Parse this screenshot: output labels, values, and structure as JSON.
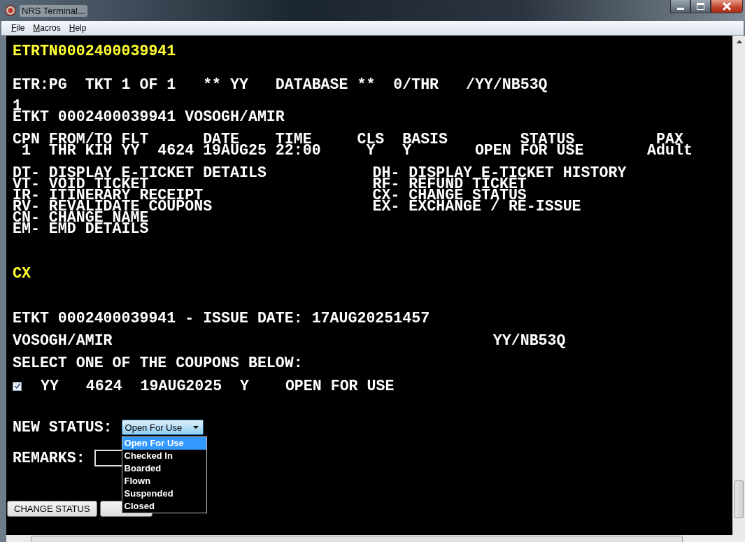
{
  "window": {
    "title": "NRS Terminal..."
  },
  "menu": [
    {
      "label": "File"
    },
    {
      "label": "Macros"
    },
    {
      "label": "Help"
    }
  ],
  "terminal": {
    "command": "ETRTN0002400039941",
    "header": "ETR:PG  TKT 1 OF 1   ** YY   DATABASE **  0/THR   /YY/NB53Q",
    "ticket_lines": [
      "1",
      "ETKT 0002400039941 VOSOGH/AMIR"
    ],
    "coupon_table": {
      "header": "CPN FROM/TO FLT      DATE    TIME     CLS  BASIS        STATUS         PAX",
      "rows": [
        " 1  THR KIH YY  4624 19AUG25 22:00     Y   Y       OPEN FOR USE       Adult"
      ]
    },
    "options": {
      "left": [
        "DT- DISPLAY E-TICKET DETAILS",
        "VT- VOID TICKET",
        "IR- ITINERARY RECEIPT",
        "RV- REVALIDATE COUPONS",
        "CN- CHANGE NAME",
        "EM- EMD DETAILS"
      ],
      "right": [
        "DH- DISPLAY E-TICKET HISTORY",
        "RF- REFUND TICKET",
        "CX- CHANGE STATUS",
        "EX- EXCHANGE / RE-ISSUE"
      ]
    },
    "command_2": "CX",
    "issue_line": "ETKT 0002400039941 - ISSUE DATE: 17AUG20251457",
    "passenger": "VOSOGH/AMIR",
    "record_locator": "YY/NB53Q",
    "prompt": "SELECT ONE OF THE COUPONS BELOW:",
    "coupons": [
      {
        "checked": true,
        "text": "YY   4624  19AUG2025  Y    OPEN FOR USE"
      }
    ],
    "new_status": {
      "label": "NEW STATUS:",
      "value": "Open For Use",
      "expanded": true,
      "options": [
        {
          "label": "Open For Use",
          "selected": true
        },
        {
          "label": "Checked In",
          "selected": false
        },
        {
          "label": "Boarded",
          "selected": false
        },
        {
          "label": "Flown",
          "selected": false
        },
        {
          "label": "Suspended",
          "selected": false
        },
        {
          "label": "Closed",
          "selected": false
        }
      ]
    },
    "remarks": {
      "label": "REMARKS:"
    },
    "buttons": [
      {
        "kind": "labeled",
        "label": "CHANGE STATUS"
      },
      {
        "kind": "covered"
      }
    ]
  }
}
